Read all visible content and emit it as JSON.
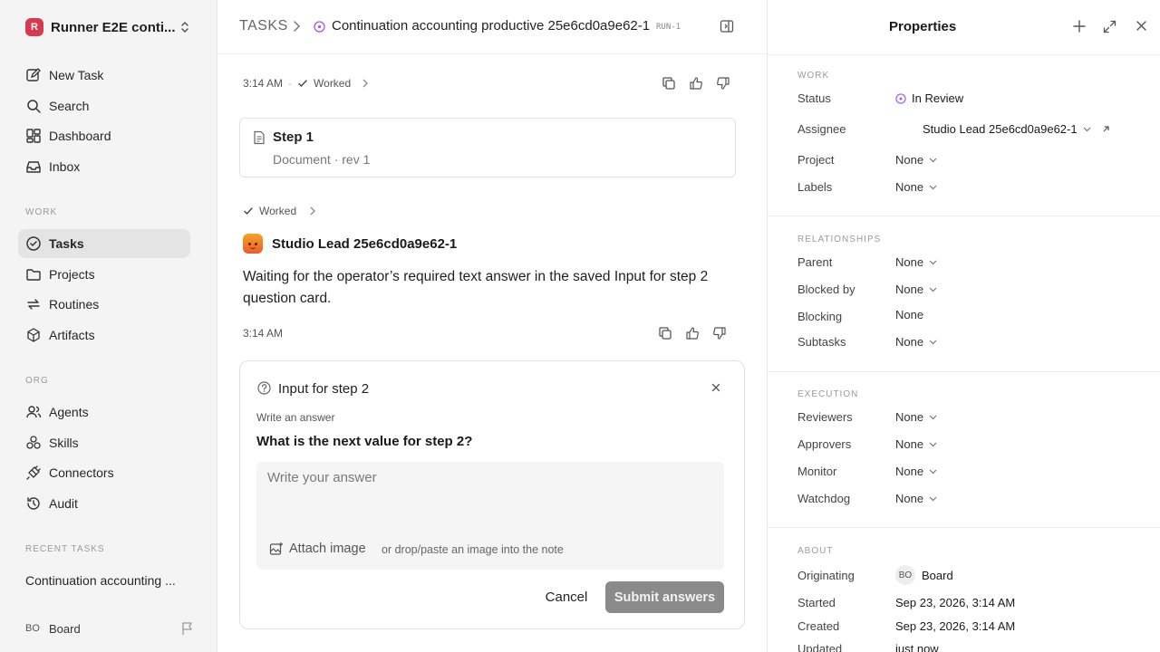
{
  "sidebar": {
    "workspace_logo": "R",
    "workspace_name": "Runner E2E conti...",
    "nav": [
      {
        "label": "New Task",
        "icon": "new-task-icon"
      },
      {
        "label": "Search",
        "icon": "search-icon"
      },
      {
        "label": "Dashboard",
        "icon": "dashboard-icon"
      },
      {
        "label": "Inbox",
        "icon": "inbox-icon"
      }
    ],
    "work_section_label": "WORK",
    "work_items": [
      {
        "label": "Tasks",
        "icon": "tasks-icon",
        "active": true
      },
      {
        "label": "Projects",
        "icon": "folder-icon"
      },
      {
        "label": "Routines",
        "icon": "routines-icon"
      },
      {
        "label": "Artifacts",
        "icon": "cube-icon"
      }
    ],
    "org_section_label": "ORG",
    "org_items": [
      {
        "label": "Agents",
        "icon": "users-icon"
      },
      {
        "label": "Skills",
        "icon": "skills-icon"
      },
      {
        "label": "Connectors",
        "icon": "plug-icon"
      },
      {
        "label": "Audit",
        "icon": "history-icon"
      }
    ],
    "recent_section_label": "RECENT TASKS",
    "recent_items": [
      "Continuation accounting ..."
    ],
    "user": {
      "initials": "BO",
      "name": "Board"
    }
  },
  "header": {
    "root": "TASKS",
    "title": "Continuation accounting productive 25e6cd0a9e62-1",
    "run_badge": "RUN-1"
  },
  "thread": {
    "first_meta": {
      "time": "3:14 AM",
      "separator": "·",
      "status": "Worked"
    },
    "doc_card": {
      "title": "Step 1",
      "subtitle": "Document · rev 1"
    },
    "second_meta": {
      "status": "Worked"
    },
    "author": "Studio Lead 25e6cd0a9e62-1",
    "message": "Waiting for the operator’s required text answer in the saved Input for step 2 question card.",
    "message_time": "3:14 AM"
  },
  "input_card": {
    "title": "Input for step 2",
    "field_label": "Write an answer",
    "question": "What is the next value for step 2?",
    "placeholder": "Write your answer",
    "attach_label": "Attach image",
    "attach_hint": "or drop/paste an image into the note",
    "cancel_label": "Cancel",
    "submit_label": "Submit answers"
  },
  "properties": {
    "title": "Properties",
    "work_section": "WORK",
    "status_label": "Status",
    "status_value": "In Review",
    "assignee_label": "Assignee",
    "assignee_value": "Studio Lead 25e6cd0a9e62-1",
    "project_label": "Project",
    "project_value": "None",
    "labels_label": "Labels",
    "labels_value": "None",
    "relationships_section": "RELATIONSHIPS",
    "parent_label": "Parent",
    "parent_value": "None",
    "blocked_by_label": "Blocked by",
    "blocked_by_value": "None",
    "blocking_label": "Blocking",
    "blocking_value": "None",
    "subtasks_label": "Subtasks",
    "subtasks_value": "None",
    "execution_section": "EXECUTION",
    "reviewers_label": "Reviewers",
    "reviewers_value": "None",
    "approvers_label": "Approvers",
    "approvers_value": "None",
    "monitor_label": "Monitor",
    "monitor_value": "None",
    "watchdog_label": "Watchdog",
    "watchdog_value": "None",
    "about_section": "ABOUT",
    "originating_label": "Originating",
    "originating_initials": "BO",
    "originating_value": "Board",
    "started_label": "Started",
    "started_value": "Sep 23, 2026, 3:14 AM",
    "created_label": "Created",
    "created_value": "Sep 23, 2026, 3:14 AM",
    "updated_label": "Updated",
    "updated_value": "just now"
  },
  "colors": {
    "brand": "#d63a4f",
    "status_in_review": "#a855f7",
    "submit_disabled": "#8a8a8a"
  }
}
